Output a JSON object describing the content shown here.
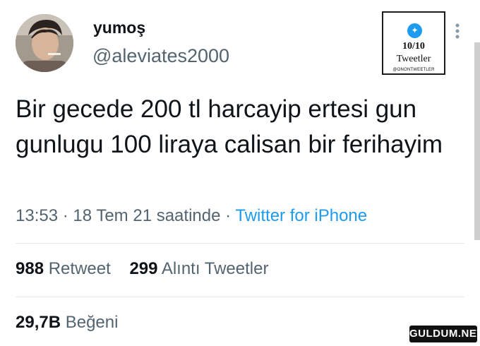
{
  "tweet": {
    "display_name": "yumoş",
    "handle": "@aleviates2000",
    "text": "Bir gecede 200 tl harcayip ertesi gun gunlugu 100 liraya calisan bir ferihayim",
    "time": "13:53",
    "date": "18 Tem 21 saatinde",
    "source": "Twitter for iPhone"
  },
  "stats": {
    "retweets_count": "988",
    "retweets_label": "Retweet",
    "quotes_count": "299",
    "quotes_label": "Alıntı Tweetler",
    "likes_count": "29,7B",
    "likes_label": "Beğeni"
  },
  "badge": {
    "score": "10/10",
    "label": "Tweetler",
    "handle": "@ONONTWEETLER"
  },
  "watermark": "GULDUM.NET",
  "colors": {
    "accent": "#1d9bf0",
    "text": "#0f1419",
    "muted": "#536471"
  },
  "icons": [
    "avatar",
    "twitter-bird-icon",
    "more-options-icon"
  ]
}
